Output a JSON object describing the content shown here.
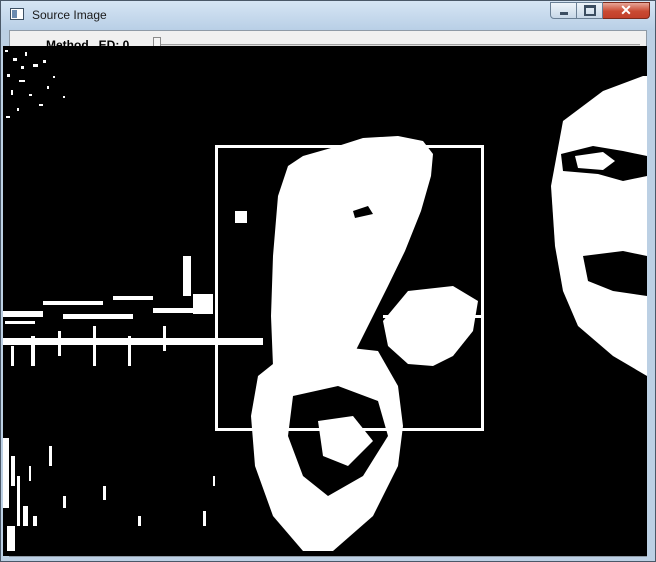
{
  "window": {
    "title": "Source Image"
  },
  "trackbar": {
    "label": "Method...ED: 0",
    "value": 0
  },
  "icons": {
    "app": "window-app-icon",
    "minimize": "minimize-icon",
    "maximize": "maximize-icon",
    "close": "close-icon"
  },
  "colors": {
    "foreground": "#ffffff",
    "background": "#000000",
    "close_button": "#c94a33"
  }
}
